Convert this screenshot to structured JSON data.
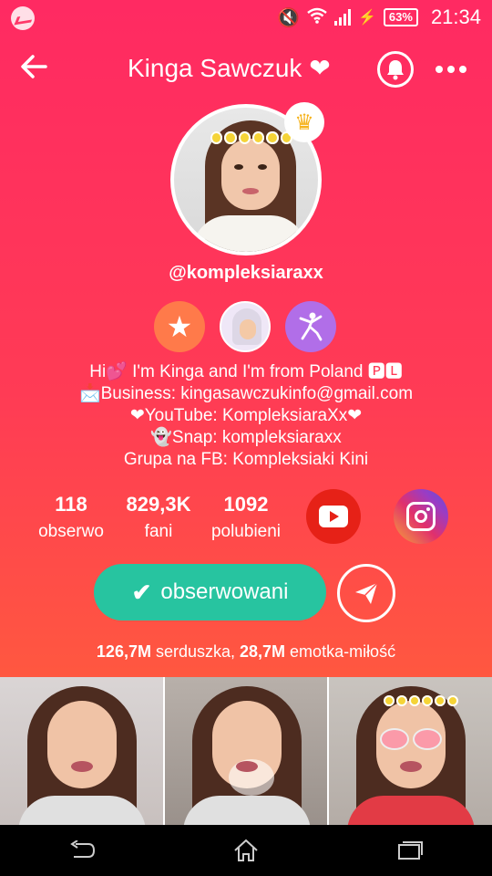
{
  "status_bar": {
    "battery": "63%",
    "time": "21:34"
  },
  "header": {
    "title": "Kinga Sawczuk ❤"
  },
  "profile": {
    "handle": "@kompleksiaraxx",
    "bio": [
      "Hi💕 I'm Kinga and I'm from Poland 🅿🅻",
      "📩Business: kingasawczukinfo@gmail.com",
      "❤YouTube: KompleksiaraXx❤",
      "👻Snap: kompleksiaraxx",
      "Grupa na FB: Kompleksiaki Kini"
    ]
  },
  "stats": [
    {
      "number": "118",
      "label": "obserwo"
    },
    {
      "number": "829,3K",
      "label": "fani"
    },
    {
      "number": "1092",
      "label": "polubieni"
    }
  ],
  "actions": {
    "follow_label": "obserwowani"
  },
  "likes": {
    "hearts_count": "126,7M",
    "hearts_label": " serduszka, ",
    "love_count": "28,7M",
    "love_label": " emotka-miłość"
  },
  "colors": {
    "bg_top": "#ff2a62",
    "bg_bottom": "#ff6a34",
    "follow_button": "#27c4a0",
    "youtube": "#e62117"
  }
}
